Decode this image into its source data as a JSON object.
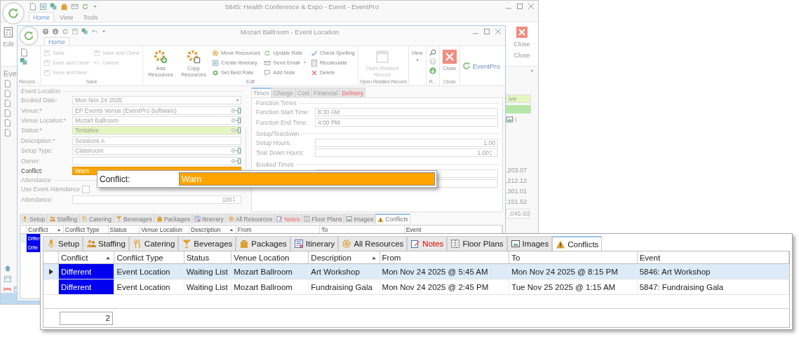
{
  "outer_window": {
    "title": "5845: Health Conference & Expo - Event - EventPro",
    "ribbon_tabs": [
      {
        "label": "Home",
        "selected": true
      },
      {
        "label": "View",
        "selected": false
      },
      {
        "label": "Tools",
        "selected": false
      }
    ],
    "edit_label": "Edit",
    "close_button": "Close",
    "close_group": "Close",
    "sidebar_heading": "Eve",
    "status_field": "ive",
    "tab_fragment": "I",
    "amounts": [
      ",203.07",
      ",212.12",
      ",301.01",
      ",151.52"
    ],
    "amount_field": ",045.50"
  },
  "window": {
    "title": "Mozart Ballroom - Event Location",
    "ribbon_tabs": [
      {
        "label": "Home",
        "selected": true
      }
    ],
    "ribbon_groups": [
      {
        "kind": "record",
        "label": "Record...",
        "buttons": [
          {
            "kind": "icon",
            "disabled": false
          },
          {
            "kind": "icon",
            "disabled": false
          }
        ]
      },
      {
        "kind": "save",
        "label": "Save",
        "buttons": [
          {
            "kind": "small",
            "label": "Save",
            "disabled": true
          },
          {
            "kind": "small",
            "label": "Save and Close",
            "disabled": true
          },
          {
            "kind": "small",
            "label": "Save and New",
            "disabled": true
          },
          {
            "kind": "small",
            "label": "Save and Clone",
            "disabled": true
          },
          {
            "kind": "small",
            "label": "Cancel",
            "disabled": true
          }
        ]
      },
      {
        "kind": "edit",
        "label": "Edit",
        "buttons": [
          {
            "kind": "large",
            "label": "Add Resources",
            "disabled": false
          },
          {
            "kind": "large",
            "label": "Copy Resources",
            "disabled": false
          },
          {
            "kind": "small",
            "label": "Move Resources",
            "disabled": false
          },
          {
            "kind": "small",
            "label": "Create Itinerary",
            "disabled": false
          },
          {
            "kind": "small",
            "label": "Set Best Rate",
            "disabled": false
          },
          {
            "kind": "small",
            "label": "Update Rate",
            "disabled": false
          },
          {
            "kind": "small",
            "label": "Send Email",
            "dropdown": true,
            "disabled": false
          },
          {
            "kind": "small",
            "label": "Add Note",
            "disabled": false
          },
          {
            "kind": "small",
            "label": "Check Spelling",
            "disabled": false
          },
          {
            "kind": "small",
            "label": "Recalculate",
            "disabled": false
          },
          {
            "kind": "small",
            "label": "Delete",
            "disabled": false
          }
        ]
      },
      {
        "kind": "related",
        "label": "Open Related Record",
        "buttons": [
          {
            "kind": "large",
            "label": "Open Related Record",
            "disabled": true
          }
        ]
      },
      {
        "kind": "view",
        "buttons": [
          {
            "kind": "large",
            "label": "View",
            "dropdown": true,
            "disabled": false
          }
        ]
      },
      {
        "kind": "nav",
        "label": "R...",
        "buttons": [
          {
            "kind": "icon",
            "disabled": false
          },
          {
            "kind": "icon",
            "disabled": true
          },
          {
            "kind": "icon",
            "disabled": false
          }
        ]
      },
      {
        "kind": "close",
        "label": "Close",
        "buttons": [
          {
            "kind": "large",
            "label": "Close",
            "disabled": false
          }
        ]
      }
    ],
    "logo": "EventPro",
    "event_location": {
      "title": "Event Location",
      "fields": [
        {
          "label": "Booked Date:",
          "value": "Mon Nov 24 2025",
          "kind": "date"
        },
        {
          "label": "Venue:*",
          "value": "EP Events Venue (EventPro Software)",
          "kind": "lookup"
        },
        {
          "label": "Venue Location:*",
          "value": "Mozart Ballroom",
          "kind": "lookup"
        },
        {
          "label": "Status:*",
          "value": "Tentative",
          "kind": "lookup",
          "color": "#e4f7c0"
        },
        {
          "label": "Description:*",
          "value": "Sessions A",
          "kind": "text"
        },
        {
          "label": "Setup Type:",
          "value": "Classroom",
          "kind": "lookup"
        },
        {
          "label": "Owner:",
          "kind": "lookup"
        },
        {
          "label": "Conflict:",
          "value": "Warn",
          "kind": "text",
          "color": "#ffa500"
        }
      ]
    },
    "attendance": {
      "title": "Attendance",
      "use_event_attendance": {
        "label": "Use Event Attendance",
        "checked": false
      },
      "attendance": {
        "label": "Attendance:",
        "value": "100"
      }
    },
    "detail_tabs": [
      {
        "label": "Times",
        "selected": true,
        "alert": false
      },
      {
        "label": "Charge",
        "selected": false,
        "alert": false
      },
      {
        "label": "Cost",
        "selected": false,
        "alert": false
      },
      {
        "label": "Financial",
        "selected": false,
        "alert": false
      },
      {
        "label": "Delivery",
        "selected": false,
        "alert": true
      }
    ],
    "detail_groups": [
      {
        "title": "Function Times",
        "fields": [
          {
            "label": "Function Start Time:",
            "value": "8:30 AM",
            "kind": "text"
          },
          {
            "label": "Function End Time:",
            "value": "4:00 PM",
            "kind": "text"
          }
        ]
      },
      {
        "title": "Setup/Teardown",
        "fields": [
          {
            "label": "Setup Hours:",
            "value": "1.00",
            "kind": "number"
          },
          {
            "label": "Tear Down Hours:",
            "value": "1.00",
            "kind": "spin"
          }
        ]
      },
      {
        "title": "Booked Times",
        "fields": [
          {
            "kind": "blank"
          },
          {
            "kind": "blank"
          }
        ]
      }
    ],
    "bottom_tabs": [
      {
        "label": "Setup",
        "selected": false,
        "alert": false
      },
      {
        "label": "Staffing",
        "selected": false,
        "alert": false
      },
      {
        "label": "Catering",
        "selected": false,
        "alert": false
      },
      {
        "label": "Beverages",
        "selected": false,
        "alert": false
      },
      {
        "label": "Packages",
        "selected": false,
        "alert": false
      },
      {
        "label": "Itinerary",
        "selected": false,
        "alert": false
      },
      {
        "label": "All Resources",
        "selected": false,
        "alert": false
      },
      {
        "label": "Notes",
        "selected": false,
        "alert": true
      },
      {
        "label": "Floor Plans",
        "selected": false,
        "alert": false
      },
      {
        "label": "Images",
        "selected": false,
        "alert": false
      },
      {
        "label": "Conflicts",
        "selected": true,
        "alert": false
      }
    ],
    "grid_columns": [
      {
        "label": "Conflict",
        "sorted": true
      },
      {
        "label": "Conflict Type",
        "sorted": false
      },
      {
        "label": "Status",
        "sorted": false
      },
      {
        "label": "Venue Location",
        "sorted": false
      },
      {
        "label": "Description",
        "sorted": true
      },
      {
        "label": "From",
        "sorted": false
      },
      {
        "label": "To",
        "sorted": false
      },
      {
        "label": "Event",
        "sorted": false
      }
    ],
    "grid_rows": [
      {
        "selected": true,
        "conflict": "Differ"
      },
      {
        "selected": false,
        "conflict": "Diffe"
      }
    ]
  },
  "conflict_callout": {
    "label": "Conflict:",
    "value": "Warn"
  },
  "conflicts_callout": {
    "tabs": [
      {
        "label": "Setup",
        "selected": false,
        "alert": false
      },
      {
        "label": "Staffing",
        "selected": false,
        "alert": false
      },
      {
        "label": "Catering",
        "selected": false,
        "alert": false
      },
      {
        "label": "Beverages",
        "selected": false,
        "alert": false
      },
      {
        "label": "Packages",
        "selected": false,
        "alert": false
      },
      {
        "label": "Itinerary",
        "selected": false,
        "alert": false
      },
      {
        "label": "All Resources",
        "selected": false,
        "alert": false
      },
      {
        "label": "Notes",
        "selected": false,
        "alert": true
      },
      {
        "label": "Floor Plans",
        "selected": false,
        "alert": false
      },
      {
        "label": "Images",
        "selected": false,
        "alert": false
      },
      {
        "label": "Conflicts",
        "selected": true,
        "alert": false
      }
    ],
    "columns": [
      {
        "label": "Conflict",
        "sorted": true
      },
      {
        "label": "Conflict Type",
        "sorted": false
      },
      {
        "label": "Status",
        "sorted": false
      },
      {
        "label": "Venue Location",
        "sorted": false
      },
      {
        "label": "Description",
        "sorted": true
      },
      {
        "label": "From",
        "sorted": false
      },
      {
        "label": "To",
        "sorted": false
      },
      {
        "label": "Event",
        "sorted": false
      }
    ],
    "rows": [
      {
        "selected": true,
        "cells": [
          "Different",
          "Event Location",
          "Waiting List",
          "Mozart Ballroom",
          "Art Workshop",
          "Mon Nov 24 2025 @ 5:45 AM",
          "Mon Nov 24 2025 @ 8:15 PM",
          "5846: Art Workshop"
        ]
      },
      {
        "selected": false,
        "cells": [
          "Different",
          "Event Location",
          "Waiting List",
          "Mozart Ballroom",
          "Fundraising Gala",
          "Mon Nov 24 2025 @ 2:45 PM",
          "Tue Nov 25 2025 @ 1:15 AM",
          "5847: Fundraising Gala"
        ]
      }
    ],
    "count": "2"
  }
}
